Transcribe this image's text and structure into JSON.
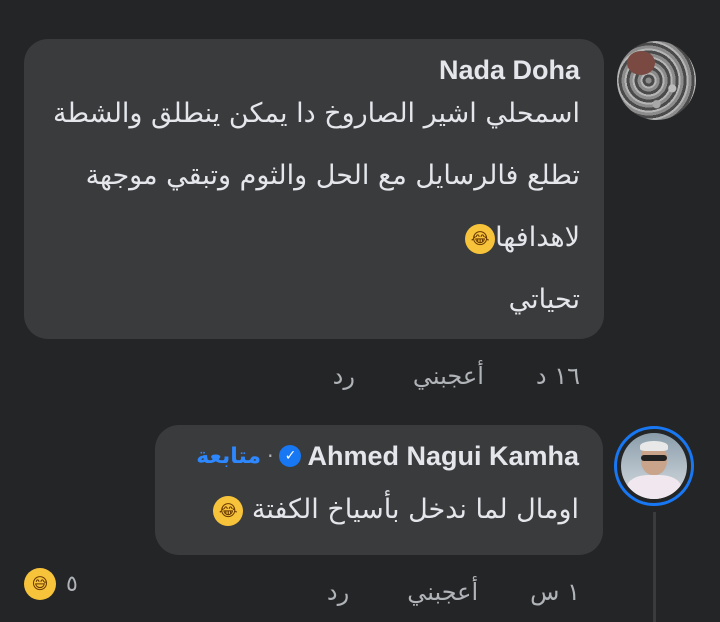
{
  "comment1": {
    "author": "Nada Doha",
    "lines": [
      "اسمحلي اشير الصاروخ دا يمكن ينطلق  والشطة",
      "تطلع فالرسايل  مع  الحل والثوم وتبقي موجهة",
      "لاهدافها",
      "تحياتي"
    ],
    "emoji": "laughing-tears-emoji",
    "time": "١٦ د",
    "like_label": "أعجبني",
    "reply_label": "رد"
  },
  "comment2": {
    "author": "Ahmed Nagui Kamha",
    "verified": true,
    "follow_label": "متابعة",
    "separator": "·",
    "text": "اومال لما ندخل بأسياخ الكفتة",
    "emoji": "laughing-tears-emoji",
    "time": "١ س",
    "like_label": "أعجبني",
    "reply_label": "رد",
    "reaction_count": "٥",
    "reaction_emoji": "grinning-sweat-emoji"
  },
  "colors": {
    "background": "#242526",
    "bubble": "#3a3b3c",
    "text": "#e4e6eb",
    "meta": "#b0b3b8",
    "accent": "#2d88ff"
  }
}
